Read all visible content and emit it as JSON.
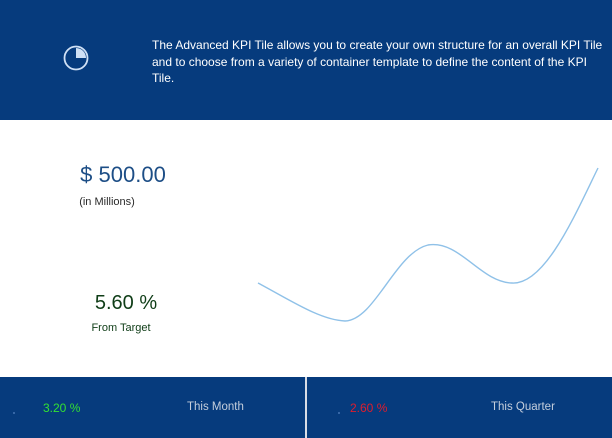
{
  "header": {
    "icon": "pie-chart-icon",
    "description": "The Advanced KPI Tile allows you to create your own structure for an overall KPI Tile and to choose from a variety of container template to define the content of the KPI Tile."
  },
  "kpi": {
    "value": "$ 500.00",
    "unit_note": "(in Millions)"
  },
  "target": {
    "value": "5.60 %",
    "label": "From Target"
  },
  "footer": {
    "month": {
      "value": "3.20 %",
      "label": "This Month",
      "value_color": "#33e033"
    },
    "quarter": {
      "value": "2.60 %",
      "label": "This Quarter",
      "value_color": "#e01d2c"
    }
  },
  "colors": {
    "brand_blue": "#063b7d",
    "trend_line": "#8fc1e8"
  }
}
